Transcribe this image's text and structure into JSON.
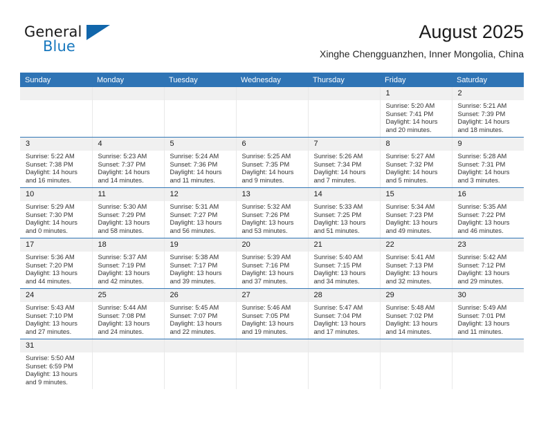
{
  "brand": {
    "name_part1": "General",
    "name_part2": "Blue",
    "triangle_color": "#1166ab",
    "blue_text_color": "#1878be"
  },
  "header": {
    "title": "August 2025",
    "subtitle": "Xinghe Chengguanzhen, Inner Mongolia, China"
  },
  "theme": {
    "header_blue": "#2f74b5",
    "daynum_band": "#f0f0f0",
    "cell_border": "#e8e8e8"
  },
  "weekday_headers": [
    "Sunday",
    "Monday",
    "Tuesday",
    "Wednesday",
    "Thursday",
    "Friday",
    "Saturday"
  ],
  "weeks": [
    [
      {
        "day": "",
        "sunrise": "",
        "sunset": "",
        "daylight1": "",
        "daylight2": ""
      },
      {
        "day": "",
        "sunrise": "",
        "sunset": "",
        "daylight1": "",
        "daylight2": ""
      },
      {
        "day": "",
        "sunrise": "",
        "sunset": "",
        "daylight1": "",
        "daylight2": ""
      },
      {
        "day": "",
        "sunrise": "",
        "sunset": "",
        "daylight1": "",
        "daylight2": ""
      },
      {
        "day": "",
        "sunrise": "",
        "sunset": "",
        "daylight1": "",
        "daylight2": ""
      },
      {
        "day": "1",
        "sunrise": "Sunrise: 5:20 AM",
        "sunset": "Sunset: 7:41 PM",
        "daylight1": "Daylight: 14 hours",
        "daylight2": "and 20 minutes."
      },
      {
        "day": "2",
        "sunrise": "Sunrise: 5:21 AM",
        "sunset": "Sunset: 7:39 PM",
        "daylight1": "Daylight: 14 hours",
        "daylight2": "and 18 minutes."
      }
    ],
    [
      {
        "day": "3",
        "sunrise": "Sunrise: 5:22 AM",
        "sunset": "Sunset: 7:38 PM",
        "daylight1": "Daylight: 14 hours",
        "daylight2": "and 16 minutes."
      },
      {
        "day": "4",
        "sunrise": "Sunrise: 5:23 AM",
        "sunset": "Sunset: 7:37 PM",
        "daylight1": "Daylight: 14 hours",
        "daylight2": "and 14 minutes."
      },
      {
        "day": "5",
        "sunrise": "Sunrise: 5:24 AM",
        "sunset": "Sunset: 7:36 PM",
        "daylight1": "Daylight: 14 hours",
        "daylight2": "and 11 minutes."
      },
      {
        "day": "6",
        "sunrise": "Sunrise: 5:25 AM",
        "sunset": "Sunset: 7:35 PM",
        "daylight1": "Daylight: 14 hours",
        "daylight2": "and 9 minutes."
      },
      {
        "day": "7",
        "sunrise": "Sunrise: 5:26 AM",
        "sunset": "Sunset: 7:34 PM",
        "daylight1": "Daylight: 14 hours",
        "daylight2": "and 7 minutes."
      },
      {
        "day": "8",
        "sunrise": "Sunrise: 5:27 AM",
        "sunset": "Sunset: 7:32 PM",
        "daylight1": "Daylight: 14 hours",
        "daylight2": "and 5 minutes."
      },
      {
        "day": "9",
        "sunrise": "Sunrise: 5:28 AM",
        "sunset": "Sunset: 7:31 PM",
        "daylight1": "Daylight: 14 hours",
        "daylight2": "and 3 minutes."
      }
    ],
    [
      {
        "day": "10",
        "sunrise": "Sunrise: 5:29 AM",
        "sunset": "Sunset: 7:30 PM",
        "daylight1": "Daylight: 14 hours",
        "daylight2": "and 0 minutes."
      },
      {
        "day": "11",
        "sunrise": "Sunrise: 5:30 AM",
        "sunset": "Sunset: 7:29 PM",
        "daylight1": "Daylight: 13 hours",
        "daylight2": "and 58 minutes."
      },
      {
        "day": "12",
        "sunrise": "Sunrise: 5:31 AM",
        "sunset": "Sunset: 7:27 PM",
        "daylight1": "Daylight: 13 hours",
        "daylight2": "and 56 minutes."
      },
      {
        "day": "13",
        "sunrise": "Sunrise: 5:32 AM",
        "sunset": "Sunset: 7:26 PM",
        "daylight1": "Daylight: 13 hours",
        "daylight2": "and 53 minutes."
      },
      {
        "day": "14",
        "sunrise": "Sunrise: 5:33 AM",
        "sunset": "Sunset: 7:25 PM",
        "daylight1": "Daylight: 13 hours",
        "daylight2": "and 51 minutes."
      },
      {
        "day": "15",
        "sunrise": "Sunrise: 5:34 AM",
        "sunset": "Sunset: 7:23 PM",
        "daylight1": "Daylight: 13 hours",
        "daylight2": "and 49 minutes."
      },
      {
        "day": "16",
        "sunrise": "Sunrise: 5:35 AM",
        "sunset": "Sunset: 7:22 PM",
        "daylight1": "Daylight: 13 hours",
        "daylight2": "and 46 minutes."
      }
    ],
    [
      {
        "day": "17",
        "sunrise": "Sunrise: 5:36 AM",
        "sunset": "Sunset: 7:20 PM",
        "daylight1": "Daylight: 13 hours",
        "daylight2": "and 44 minutes."
      },
      {
        "day": "18",
        "sunrise": "Sunrise: 5:37 AM",
        "sunset": "Sunset: 7:19 PM",
        "daylight1": "Daylight: 13 hours",
        "daylight2": "and 42 minutes."
      },
      {
        "day": "19",
        "sunrise": "Sunrise: 5:38 AM",
        "sunset": "Sunset: 7:17 PM",
        "daylight1": "Daylight: 13 hours",
        "daylight2": "and 39 minutes."
      },
      {
        "day": "20",
        "sunrise": "Sunrise: 5:39 AM",
        "sunset": "Sunset: 7:16 PM",
        "daylight1": "Daylight: 13 hours",
        "daylight2": "and 37 minutes."
      },
      {
        "day": "21",
        "sunrise": "Sunrise: 5:40 AM",
        "sunset": "Sunset: 7:15 PM",
        "daylight1": "Daylight: 13 hours",
        "daylight2": "and 34 minutes."
      },
      {
        "day": "22",
        "sunrise": "Sunrise: 5:41 AM",
        "sunset": "Sunset: 7:13 PM",
        "daylight1": "Daylight: 13 hours",
        "daylight2": "and 32 minutes."
      },
      {
        "day": "23",
        "sunrise": "Sunrise: 5:42 AM",
        "sunset": "Sunset: 7:12 PM",
        "daylight1": "Daylight: 13 hours",
        "daylight2": "and 29 minutes."
      }
    ],
    [
      {
        "day": "24",
        "sunrise": "Sunrise: 5:43 AM",
        "sunset": "Sunset: 7:10 PM",
        "daylight1": "Daylight: 13 hours",
        "daylight2": "and 27 minutes."
      },
      {
        "day": "25",
        "sunrise": "Sunrise: 5:44 AM",
        "sunset": "Sunset: 7:08 PM",
        "daylight1": "Daylight: 13 hours",
        "daylight2": "and 24 minutes."
      },
      {
        "day": "26",
        "sunrise": "Sunrise: 5:45 AM",
        "sunset": "Sunset: 7:07 PM",
        "daylight1": "Daylight: 13 hours",
        "daylight2": "and 22 minutes."
      },
      {
        "day": "27",
        "sunrise": "Sunrise: 5:46 AM",
        "sunset": "Sunset: 7:05 PM",
        "daylight1": "Daylight: 13 hours",
        "daylight2": "and 19 minutes."
      },
      {
        "day": "28",
        "sunrise": "Sunrise: 5:47 AM",
        "sunset": "Sunset: 7:04 PM",
        "daylight1": "Daylight: 13 hours",
        "daylight2": "and 17 minutes."
      },
      {
        "day": "29",
        "sunrise": "Sunrise: 5:48 AM",
        "sunset": "Sunset: 7:02 PM",
        "daylight1": "Daylight: 13 hours",
        "daylight2": "and 14 minutes."
      },
      {
        "day": "30",
        "sunrise": "Sunrise: 5:49 AM",
        "sunset": "Sunset: 7:01 PM",
        "daylight1": "Daylight: 13 hours",
        "daylight2": "and 11 minutes."
      }
    ],
    [
      {
        "day": "31",
        "sunrise": "Sunrise: 5:50 AM",
        "sunset": "Sunset: 6:59 PM",
        "daylight1": "Daylight: 13 hours",
        "daylight2": "and 9 minutes."
      },
      {
        "day": "",
        "sunrise": "",
        "sunset": "",
        "daylight1": "",
        "daylight2": ""
      },
      {
        "day": "",
        "sunrise": "",
        "sunset": "",
        "daylight1": "",
        "daylight2": ""
      },
      {
        "day": "",
        "sunrise": "",
        "sunset": "",
        "daylight1": "",
        "daylight2": ""
      },
      {
        "day": "",
        "sunrise": "",
        "sunset": "",
        "daylight1": "",
        "daylight2": ""
      },
      {
        "day": "",
        "sunrise": "",
        "sunset": "",
        "daylight1": "",
        "daylight2": ""
      },
      {
        "day": "",
        "sunrise": "",
        "sunset": "",
        "daylight1": "",
        "daylight2": ""
      }
    ]
  ]
}
